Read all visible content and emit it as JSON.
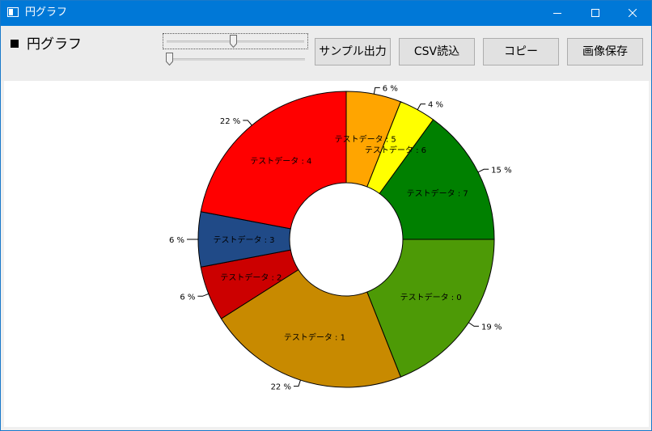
{
  "window": {
    "title": "円グラフ",
    "icon": "app-window-icon"
  },
  "controls": {
    "minimize": "minimize-icon",
    "maximize": "maximize-icon",
    "close": "close-icon"
  },
  "toolbar": {
    "heading_marker": "■",
    "heading": "円グラフ",
    "slider1_value": 0.48,
    "slider2_value": 0.0,
    "buttons": [
      "サンプル出力",
      "CSV読込",
      "コピー",
      "画像保存"
    ]
  },
  "chart_data": {
    "type": "pie",
    "style": "donut",
    "label_prefix": "テストデータ : ",
    "percent_suffix": " %",
    "slices": [
      {
        "name": "テストデータ : 0",
        "label": "0",
        "value": 19,
        "color": "#4d9a06"
      },
      {
        "name": "テストデータ : 1",
        "label": "1",
        "value": 22,
        "color": "#c88a00"
      },
      {
        "name": "テストデータ : 2",
        "label": "2",
        "value": 6,
        "color": "#cc0000"
      },
      {
        "name": "テストデータ : 3",
        "label": "3",
        "value": 6,
        "color": "#204a87"
      },
      {
        "name": "テストデータ : 4",
        "label": "4",
        "value": 22,
        "color": "#ff0000"
      },
      {
        "name": "テストデータ : 5",
        "label": "5",
        "value": 6,
        "color": "#ffa500"
      },
      {
        "name": "テストデータ : 6",
        "label": "6",
        "value": 4,
        "color": "#ffff00"
      },
      {
        "name": "テストデータ : 7",
        "label": "7",
        "value": 15,
        "color": "#008000"
      }
    ]
  }
}
